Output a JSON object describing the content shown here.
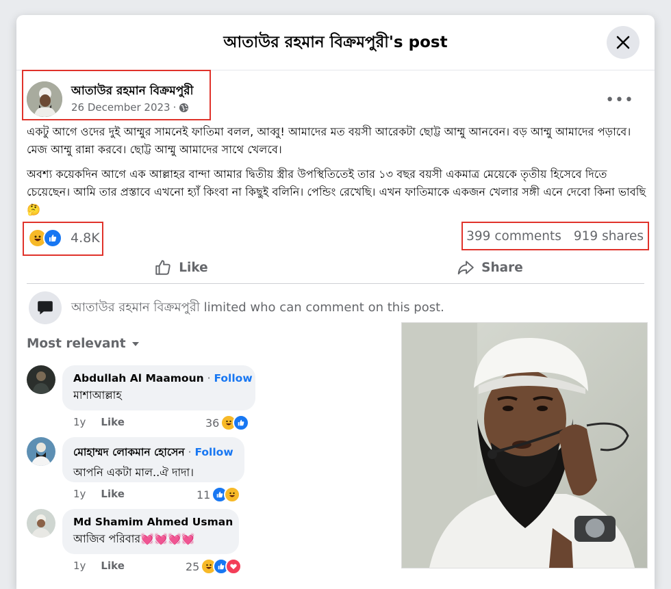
{
  "modal": {
    "title": "আতাউর রহমান বিক্রমপুরী's post"
  },
  "post": {
    "author": "আতাউর রহমান বিক্রমপুরী",
    "date": "26 December 2023",
    "date_suffix": "·",
    "paragraphs": [
      "একটু আগে ওদের দুই আম্মুর সামনেই ফাতিমা বলল, আব্বু! আমাদের মত বয়সী আরেকটা ছোট্ট আম্মু আনবেন। বড় আম্মু আমাদের পড়াবে। মেজ আম্মু রান্না করবে। ছোট্ট আম্মু আমাদের সাথে খেলবে।",
      "অবশ্য কয়েকদিন আগে এক আল্লাহর বান্দা আমার দ্বিতীয় স্ত্রীর উপস্থিতিতেই তার ১৩ বছর বয়সী একমাত্র মেয়েকে তৃতীয় হিসেবে দিতে চেয়েছেন। আমি তার প্রস্তাবে এখনো হ্যাঁ কিংবা না কিছুই বলিনি। পেন্ডিং রেখেছি। এখন ফাতিমাকে একজন খেলার সঙ্গী এনে দেবো কিনা ভাবছি 🤔"
    ],
    "reaction_count": "4.8K",
    "comments_count": "399 comments",
    "shares_count": "919 shares"
  },
  "actions": {
    "like": "Like",
    "share": "Share"
  },
  "limited_notice": {
    "name": "আতাউর রহমান বিক্রমপুরী",
    "text": " limited who can comment on this post."
  },
  "sort_label": "Most relevant",
  "comments": [
    {
      "name": "Abdullah Al Maamoun",
      "follow": "Follow",
      "dot": " · ",
      "text": "মাশাআল্লাহ",
      "age": "1y",
      "like": "Like",
      "count": "36"
    },
    {
      "name": "মোহাম্মদ লোকমান হোসেন",
      "follow": "Follow",
      "dot": " · ",
      "text": "আপনি একটা মাল..ঐ দাদা।",
      "age": "1y",
      "like": "Like",
      "count": "11"
    },
    {
      "name": "Md Shamim Ahmed Usman",
      "text": "আজিব পরিবার💓💓💓💓",
      "age": "1y",
      "like": "Like",
      "count": "25"
    }
  ],
  "icons": {
    "close": "close-icon",
    "globe": "globe-icon",
    "more": "more-icon",
    "like": "like-icon",
    "share": "share-icon",
    "chat": "chat-bubble-icon",
    "chevron": "chevron-down-icon"
  },
  "colors": {
    "accent": "#1877f2",
    "highlight_border": "#e0322a",
    "haha": "#f7b928",
    "love": "#f33e58"
  }
}
